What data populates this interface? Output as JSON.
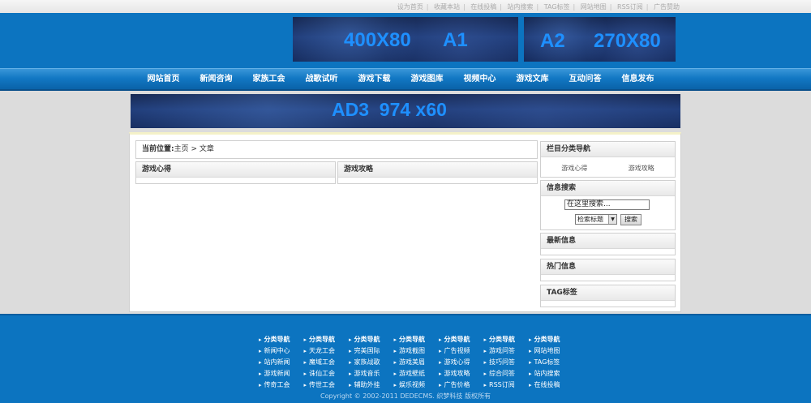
{
  "top_links": [
    "设为首页",
    "收藏本站",
    "在线投稿",
    "站内搜索",
    "TAG标签",
    "网站地图",
    "RSS订阅",
    "广告赞助"
  ],
  "ads": {
    "a1": {
      "size": "400X80",
      "name": "A1"
    },
    "a2": {
      "name": "A2",
      "size": "270X80"
    },
    "a3": {
      "name": "AD3",
      "size": "974 x60"
    }
  },
  "nav": [
    "网站首页",
    "新闻咨询",
    "家族工会",
    "战歌试听",
    "游戏下载",
    "游戏图库",
    "视频中心",
    "游戏文库",
    "互动问答",
    "信息发布"
  ],
  "breadcrumb": {
    "label": "当前位置:",
    "path": "主页 > 文章"
  },
  "content_boxes": [
    "游戏心得",
    "游戏攻略"
  ],
  "sidebar": {
    "category": {
      "title": "栏目分类导航",
      "links": [
        "游戏心得",
        "游戏攻略"
      ]
    },
    "search": {
      "title": "信息搜索",
      "input_value": "在这里搜索...",
      "select_value": "检索标题",
      "button": "搜索"
    },
    "latest": {
      "title": "最新信息"
    },
    "hot": {
      "title": "热门信息"
    },
    "tags": {
      "title": "TAG标签"
    }
  },
  "footer": {
    "columns": [
      [
        "分类导航",
        "新闻中心",
        "站内新闻",
        "游戏新闻",
        "传奇工会"
      ],
      [
        "分类导航",
        "天龙工会",
        "魔域工会",
        "诛仙工会",
        "传世工会"
      ],
      [
        "分类导航",
        "完美国际",
        "家族战歌",
        "游戏音乐",
        "辅助外挂"
      ],
      [
        "分类导航",
        "游戏截图",
        "游戏美眉",
        "游戏壁纸",
        "娱乐视频"
      ],
      [
        "分类导航",
        "广告视频",
        "游戏心得",
        "游戏攻略",
        "广告价格"
      ],
      [
        "分类导航",
        "游戏问答",
        "技巧问答",
        "综合问答",
        "RSS订阅"
      ],
      [
        "分类导航",
        "网站地图",
        "TAG标签",
        "站内搜索",
        "在线投稿"
      ]
    ],
    "copyright": "Copyright © 2002-2011 DEDECMS. 织梦科技 版权所有"
  }
}
